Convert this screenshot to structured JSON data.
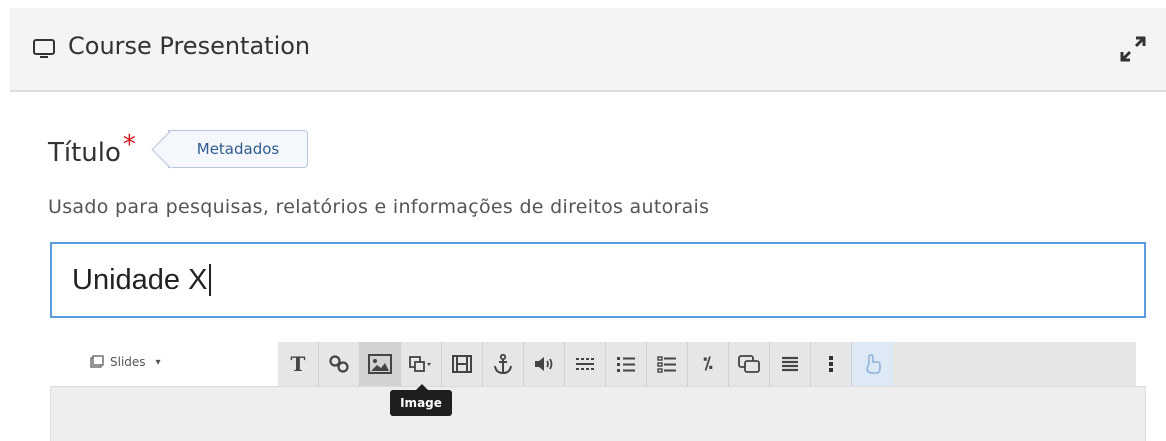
{
  "header": {
    "title": "Course Presentation",
    "icon": "monitor-icon",
    "expand_icon": "expand-icon"
  },
  "form": {
    "label": "Título",
    "required_mark": "*",
    "metadata_button": "Metadados",
    "description": "Usado para pesquisas, relatórios e informações de direitos autorais",
    "title_value": "Unidade X"
  },
  "editor": {
    "slides_label": "Slides",
    "slides_caret": "▾",
    "toolbar": [
      {
        "name": "text-tool",
        "icon": "text-icon"
      },
      {
        "name": "link-tool",
        "icon": "link-icon"
      },
      {
        "name": "image-tool",
        "icon": "image-icon",
        "active": true
      },
      {
        "name": "shapes-tool",
        "icon": "shapes-icon"
      },
      {
        "name": "video-tool",
        "icon": "video-icon"
      },
      {
        "name": "anchor-tool",
        "icon": "anchor-icon"
      },
      {
        "name": "audio-tool",
        "icon": "audio-icon"
      },
      {
        "name": "fill-blanks-tool",
        "icon": "fill-blanks-icon"
      },
      {
        "name": "single-choice-tool",
        "icon": "list-icon"
      },
      {
        "name": "multiple-choice-tool",
        "icon": "checklist-icon"
      },
      {
        "name": "true-false-tool",
        "icon": "percent-icon"
      },
      {
        "name": "dialog-cards-tool",
        "icon": "dialog-icon"
      },
      {
        "name": "summary-tool",
        "icon": "summary-icon"
      },
      {
        "name": "more-tool",
        "icon": "more-icon"
      },
      {
        "name": "interaction-tool",
        "icon": "hand-icon"
      }
    ],
    "tooltip": "Image"
  }
}
